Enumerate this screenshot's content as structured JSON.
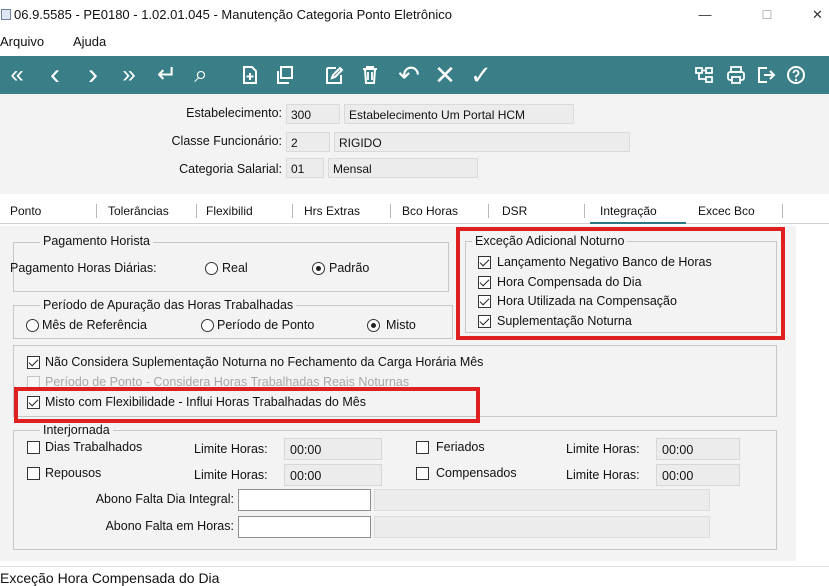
{
  "window": {
    "title": "06.9.5585 - PE0180 - 1.02.01.045 - Manutenção Categoria Ponto Eletrônico",
    "minimize": "—",
    "maximize": "☐",
    "close": "✕"
  },
  "menu": {
    "items": [
      "Arquivo",
      "Ajuda"
    ]
  },
  "toolbar": {
    "first": "«",
    "prev": "‹",
    "next": "›",
    "last": "»",
    "goto": "↵",
    "search": "⌕",
    "undo": "↶",
    "cancel": "✕",
    "confirm": "✓"
  },
  "header": {
    "estabelecimento": {
      "label": "Estabelecimento:",
      "code": "300",
      "desc": "Estabelecimento Um Portal HCM"
    },
    "classe": {
      "label": "Classe Funcionário:",
      "code": "2",
      "desc": "RIGIDO"
    },
    "categoria": {
      "label": "Categoria Salarial:",
      "code": "01",
      "desc": "Mensal"
    }
  },
  "tabs": [
    "Ponto",
    "Tolerâncias",
    "Flexibilid",
    "Hrs Extras",
    "Bco Horas",
    "DSR",
    "Integração",
    "Excec Bco"
  ],
  "pagamento": {
    "title": "Pagamento Horista",
    "label": "Pagamento Horas Diárias:",
    "real": "Real",
    "padrao": "Padrão"
  },
  "periodo": {
    "title": "Período de Apuração das Horas Trabalhadas",
    "mes": "Mês de Referência",
    "ponto": "Período de Ponto",
    "misto": "Misto"
  },
  "excecao": {
    "title": "Exceção Adicional Noturno",
    "items": [
      "Lançamento Negativo Banco de Horas",
      "Hora Compensada do Dia",
      "Hora Utilizada na Compensação",
      "Suplementação Noturna"
    ]
  },
  "options": {
    "nao_considera": "Não Considera Suplementação Noturna no Fechamento da Carga Horária Mês",
    "periodo_ponto": "Período de Ponto - Considera Horas Trabalhadas Reais Noturnas",
    "misto_flex": "Misto com Flexibilidade - Influi Horas Trabalhadas do Mês"
  },
  "interjornada": {
    "title": "Interjornada",
    "dias": "Dias Trabalhados",
    "repousos": "Repousos",
    "feriados": "Feriados",
    "compensados": "Compensados",
    "limite_label": "Limite Horas:",
    "dias_limite": "00:00",
    "repousos_limite": "00:00",
    "feriados_limite": "00:00",
    "compensados_limite": "00:00",
    "abono_integral": "Abono Falta Dia Integral:",
    "abono_horas": "Abono Falta em Horas:"
  },
  "status": {
    "text": "Exceção Hora Compensada do Dia"
  }
}
